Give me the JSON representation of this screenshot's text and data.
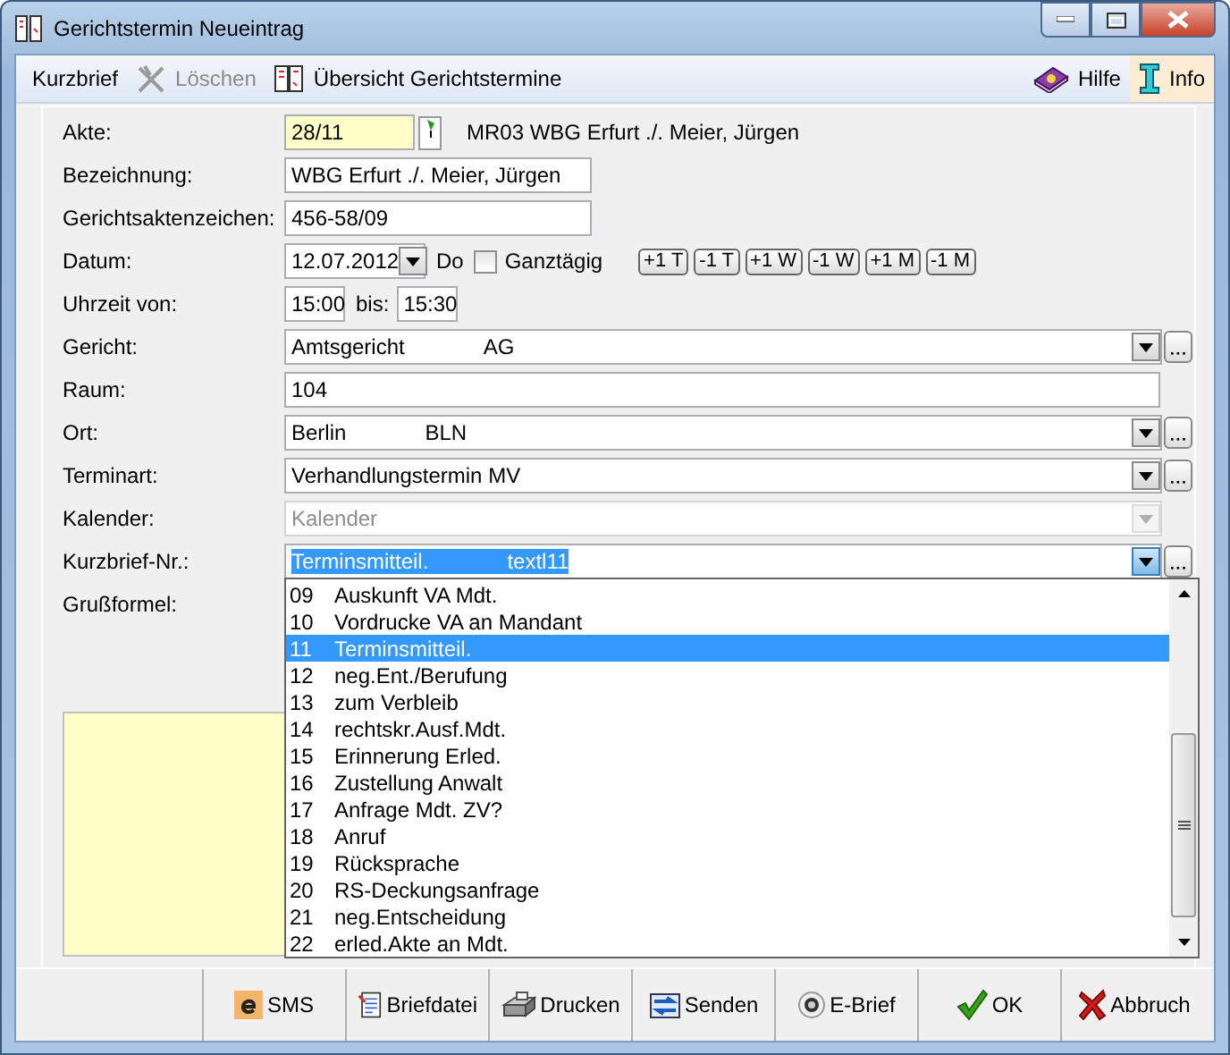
{
  "window": {
    "title": "Gerichtstermin Neueintrag"
  },
  "toolbar": {
    "left": [
      {
        "label": "Kurzbrief",
        "disabled": false
      },
      {
        "label": "Löschen",
        "disabled": true
      },
      {
        "label": "Übersicht Gerichtstermine",
        "disabled": false
      }
    ],
    "right": [
      {
        "label": "Hilfe",
        "selected": false
      },
      {
        "label": "Info",
        "selected": true
      }
    ]
  },
  "form": {
    "akte": {
      "label": "Akte:",
      "value": "28/11",
      "description": "MR03 WBG Erfurt ./. Meier, Jürgen"
    },
    "bezeichnung": {
      "label": "Bezeichnung:",
      "value": "WBG Erfurt ./. Meier, Jürgen"
    },
    "gerichtsaktenzeichen": {
      "label": "Gerichtsaktenzeichen:",
      "value": "456-58/09"
    },
    "datum": {
      "label": "Datum:",
      "value": "12.07.2012",
      "weekday": "Do",
      "all_day": {
        "label": "Ganztägig",
        "checked": false
      },
      "shift_buttons": [
        "+1 T",
        "-1 T",
        "+1 W",
        "-1 W",
        "+1 M",
        "-1 M"
      ]
    },
    "uhrzeit": {
      "label": "Uhrzeit von:",
      "from": "15:00",
      "to_label": "bis:",
      "to": "15:30"
    },
    "rows": [
      {
        "kind": "combo",
        "label": "Gericht:",
        "value": "Amtsgericht",
        "code": "AG",
        "disabled": false,
        "selected": false
      },
      {
        "kind": "text",
        "label": "Raum:",
        "value": "104"
      },
      {
        "kind": "combo",
        "label": "Ort:",
        "value": "Berlin",
        "code": "BLN",
        "disabled": false,
        "selected": false
      },
      {
        "kind": "combo",
        "label": "Terminart:",
        "value": "Verhandlungstermin MV",
        "disabled": false,
        "selected": false
      },
      {
        "kind": "combo",
        "label": "Kalender:",
        "value": "Kalender",
        "disabled": true,
        "selected": false
      },
      {
        "kind": "combo",
        "label": "Kurzbrief-Nr.:",
        "value": "Terminsmitteil.",
        "code": "textl11",
        "disabled": false,
        "selected": true
      }
    ],
    "grussformel": {
      "label": "Grußformel:"
    }
  },
  "dropdown": {
    "items": [
      {
        "number": "09",
        "label": "Auskunft VA Mdt.",
        "selected": false
      },
      {
        "number": "10",
        "label": "Vordrucke VA an Mandant",
        "selected": false
      },
      {
        "number": "11",
        "label": "Terminsmitteil.",
        "selected": true
      },
      {
        "number": "12",
        "label": "neg.Ent./Berufung",
        "selected": false
      },
      {
        "number": "13",
        "label": "zum Verbleib",
        "selected": false
      },
      {
        "number": "14",
        "label": "rechtskr.Ausf.Mdt.",
        "selected": false
      },
      {
        "number": "15",
        "label": "Erinnerung Erled.",
        "selected": false
      },
      {
        "number": "16",
        "label": "Zustellung Anwalt",
        "selected": false
      },
      {
        "number": "17",
        "label": "Anfrage Mdt. ZV?",
        "selected": false
      },
      {
        "number": "18",
        "label": "Anruf",
        "selected": false
      },
      {
        "number": "19",
        "label": "Rücksprache",
        "selected": false
      },
      {
        "number": "20",
        "label": "RS-Deckungsanfrage",
        "selected": false
      },
      {
        "number": "21",
        "label": "neg.Entscheidung",
        "selected": false
      },
      {
        "number": "22",
        "label": "erled.Akte an Mdt.",
        "selected": false
      }
    ]
  },
  "buttons": [
    {
      "label": "SMS"
    },
    {
      "label": "Briefdatei"
    },
    {
      "label": "Drucken"
    },
    {
      "label": "Senden"
    },
    {
      "label": "E-Brief"
    },
    {
      "label": "OK"
    },
    {
      "label": "Abbruch"
    }
  ]
}
